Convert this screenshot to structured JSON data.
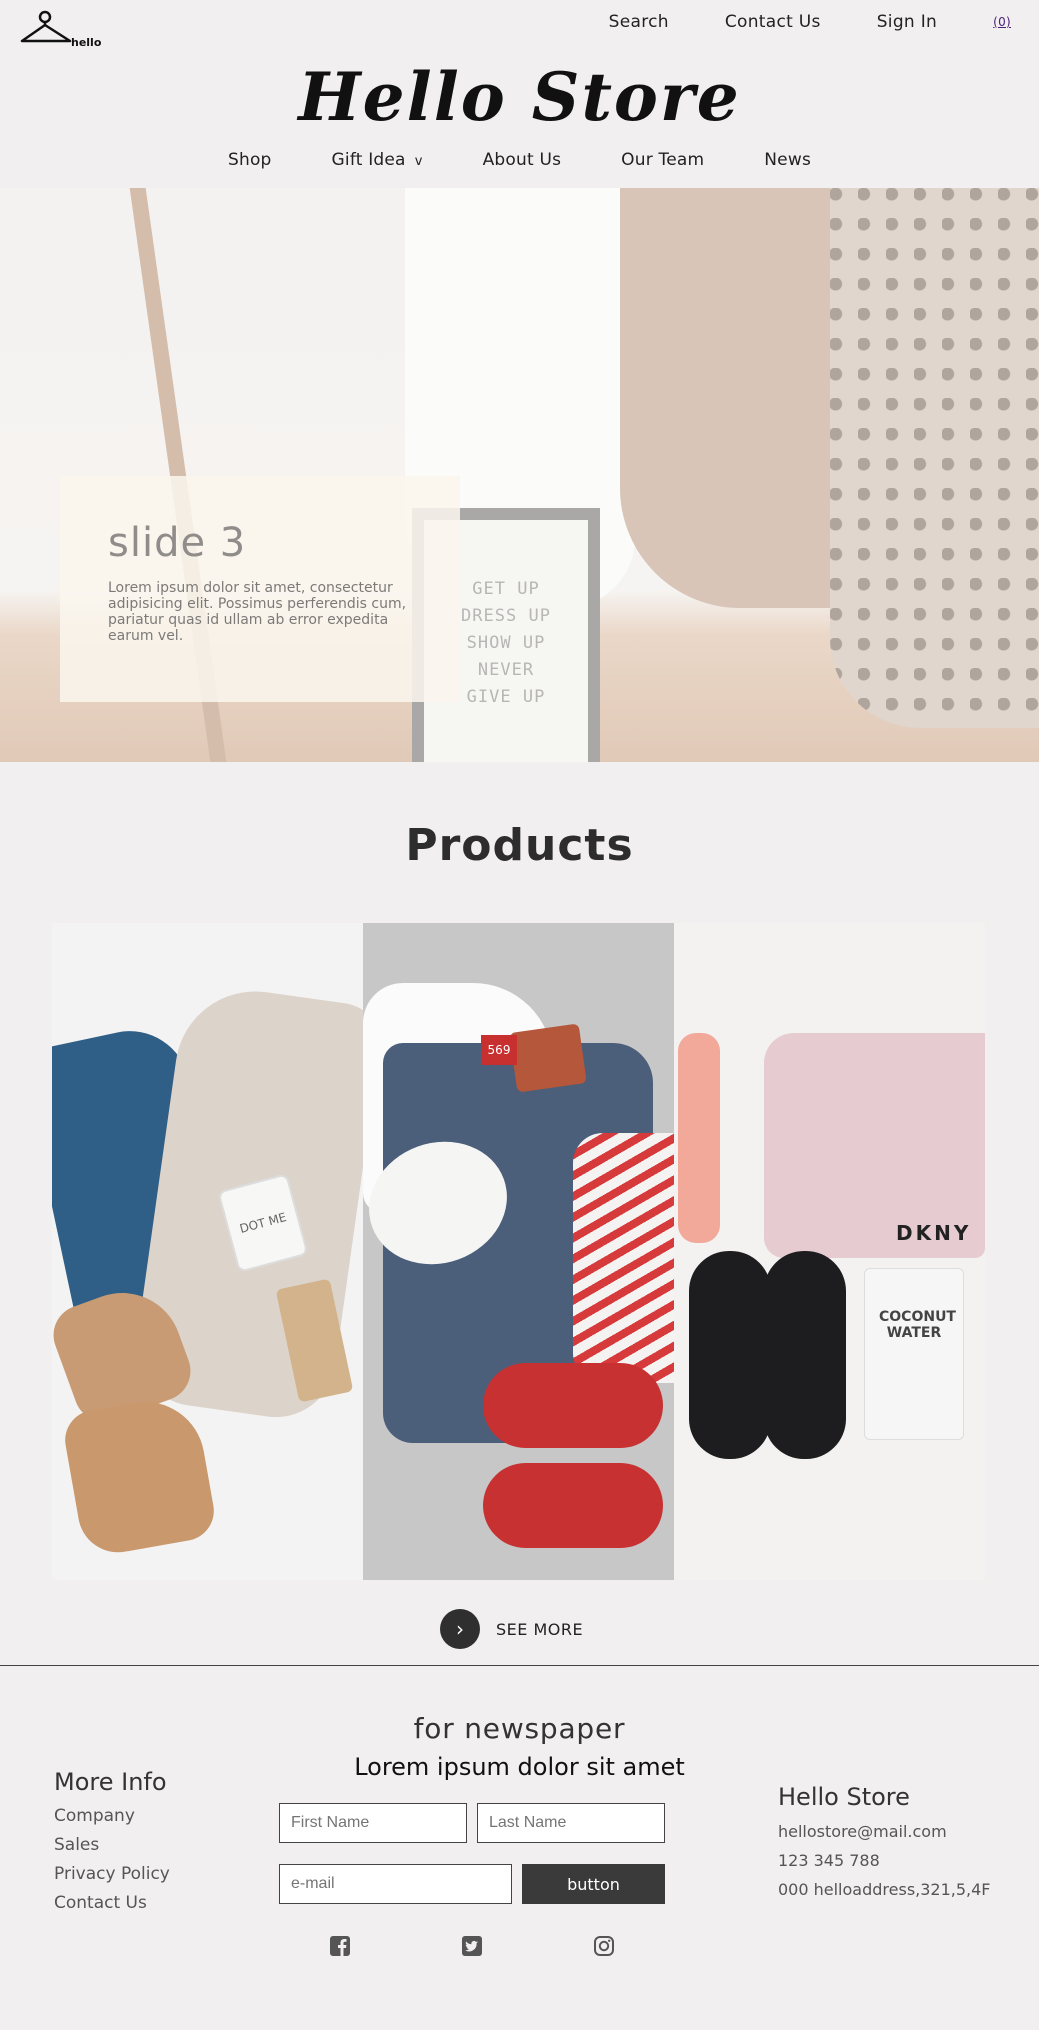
{
  "header": {
    "logo_text": "hello",
    "top_links": [
      "Search",
      "Contact Us",
      "Sign In"
    ],
    "cart_label": "(0)",
    "brand": "Hello Store",
    "main_nav": [
      "Shop",
      "Gift Idea",
      "About Us",
      "Our Team",
      "News"
    ],
    "dropdown_icon": "chevron-down-icon"
  },
  "hero": {
    "slide_title": "slide 3",
    "slide_text": "Lorem ipsum dolor sit amet, consectetur adipisicing elit. Possimus perferendis cum, pariatur quas id ullam ab error expedita earum vel.",
    "board_lines": [
      "GET UP",
      "DRESS UP",
      "SHOW UP",
      "NEVER",
      "GIVE UP"
    ]
  },
  "products": {
    "title": "Products",
    "tiles": [
      {
        "name": "sweater-jeans-boots",
        "print": "DOT ME"
      },
      {
        "name": "shirt-jeans-sandals",
        "label_number": "569"
      },
      {
        "name": "bra-sneakers-coconut",
        "brand_mark": "DKNY",
        "pack_text": "COCONUT WATER"
      }
    ],
    "see_more": "SEE MORE"
  },
  "footer": {
    "newsletter_title": "for newspaper",
    "newsletter_subtitle": "Lorem ipsum dolor sit amet",
    "first_name_placeholder": "First Name",
    "last_name_placeholder": "Last Name",
    "email_placeholder": "e-mail",
    "button_label": "button",
    "more_info_title": "More Info",
    "more_info_links": [
      "Company",
      "Sales",
      "Privacy Policy",
      "Contact Us"
    ],
    "store_title": "Hello Store",
    "store_email": "hellostore@mail.com",
    "store_phone": "123 345 788",
    "store_address": "000 helloaddress,321,5,4F",
    "social_icons": [
      "facebook-icon",
      "twitter-icon",
      "instagram-icon"
    ]
  }
}
